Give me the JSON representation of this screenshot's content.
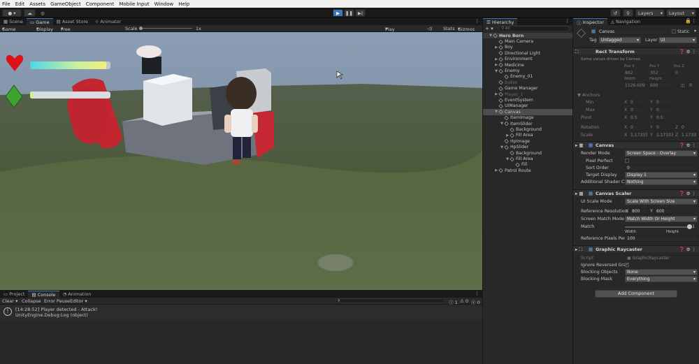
{
  "menu": [
    "File",
    "Edit",
    "Assets",
    "GameObject",
    "Component",
    "Mobile Input",
    "Window",
    "Help"
  ],
  "toolbar": {
    "layers": "Layers",
    "layout": "Layout"
  },
  "game_tabs": [
    "Scene",
    "Game",
    "Asset Store",
    "Animator"
  ],
  "game_bar": {
    "display_mode": "Game",
    "display": "Display 1",
    "aspect": "Free Aspect",
    "scale_label": "Scale",
    "scale_value": "1x",
    "play_focused": "Play Focused",
    "stats": "Stats",
    "gizmos": "Gizmos"
  },
  "hud": {
    "health": 0.95,
    "item": 0.04
  },
  "hierarchy": {
    "title": "Hierarchy",
    "search": "All",
    "items": [
      {
        "label": "Hero Born",
        "depth": 0,
        "arrow": "▼",
        "root": true
      },
      {
        "label": "Main Camera",
        "depth": 1,
        "arrow": ""
      },
      {
        "label": "Boy",
        "depth": 1,
        "arrow": "▶"
      },
      {
        "label": "Directional Light",
        "depth": 1,
        "arrow": ""
      },
      {
        "label": "Environment",
        "depth": 1,
        "arrow": "▶"
      },
      {
        "label": "Medicine",
        "depth": 1,
        "arrow": "▶"
      },
      {
        "label": "Enemy",
        "depth": 1,
        "arrow": "▼"
      },
      {
        "label": "Enemy_01",
        "depth": 2,
        "arrow": ""
      },
      {
        "label": "Bullet",
        "depth": 1,
        "arrow": "",
        "dim": true
      },
      {
        "label": "Game Manager",
        "depth": 1,
        "arrow": ""
      },
      {
        "label": "Player_1",
        "depth": 1,
        "arrow": "▶",
        "dim": true
      },
      {
        "label": "EventSystem",
        "depth": 1,
        "arrow": ""
      },
      {
        "label": "UIManager",
        "depth": 1,
        "arrow": ""
      },
      {
        "label": "Canvas",
        "depth": 1,
        "arrow": "▼",
        "selected": true
      },
      {
        "label": "ItemImage",
        "depth": 2,
        "arrow": ""
      },
      {
        "label": "ItemSlider",
        "depth": 2,
        "arrow": "▼"
      },
      {
        "label": "Background",
        "depth": 3,
        "arrow": ""
      },
      {
        "label": "Fill Area",
        "depth": 3,
        "arrow": "▶"
      },
      {
        "label": "HpImage",
        "depth": 2,
        "arrow": ""
      },
      {
        "label": "HpSlider",
        "depth": 2,
        "arrow": "▼"
      },
      {
        "label": "Background",
        "depth": 3,
        "arrow": ""
      },
      {
        "label": "Fill Area",
        "depth": 3,
        "arrow": "▼"
      },
      {
        "label": "Fill",
        "depth": 4,
        "arrow": ""
      },
      {
        "label": "Patrol Route",
        "depth": 1,
        "arrow": "▶"
      }
    ]
  },
  "inspector": {
    "tabs": [
      "Inspector",
      "Navigation"
    ],
    "name": "Canvas",
    "static": "Static",
    "tag_label": "Tag",
    "tag": "Untagged",
    "layer_label": "Layer",
    "layer": "UI",
    "rect": {
      "title": "Rect Transform",
      "note": "Some values driven by Canvas.",
      "h_posx": "Pos X",
      "h_posy": "Pos Y",
      "h_posz": "Pos Z",
      "posx": "862",
      "posy": "352",
      "posz": "0",
      "h_w": "Width",
      "h_h": "Height",
      "w": "1126.609",
      "h": "600",
      "anchors": "Anchors",
      "min": "Min",
      "max": "Max",
      "ax": "X",
      "ay": "Y",
      "min_x": "0",
      "min_y": "0",
      "max_x": "0",
      "max_y": "0",
      "pivot": "Pivot",
      "piv_x": "0.5",
      "piv_y": "0.5",
      "rotation": "Rotation",
      "rx": "0",
      "ry": "0",
      "rz": "0",
      "az": "Z",
      "scale": "Scale",
      "sx": "1.17333",
      "sy": "1.17333",
      "sz": "1.17333",
      "r_btn": "R"
    },
    "canvas": {
      "title": "Canvas",
      "render_mode_l": "Render Mode",
      "render_mode": "Screen Space - Overlay",
      "pixel_perfect": "Pixel Perfect",
      "sort_order_l": "Sort Order",
      "sort_order": "0",
      "target_display_l": "Target Display",
      "target_display": "Display 1",
      "add_shader_l": "Additional Shader Ch",
      "add_shader": "Nothing"
    },
    "scaler": {
      "title": "Canvas Scaler",
      "ui_scale_l": "UI Scale Mode",
      "ui_scale": "Scale With Screen Size",
      "ref_res_l": "Reference Resolution",
      "ref_x": "800",
      "ref_y": "600",
      "match_mode_l": "Screen Match Mode",
      "match_mode": "Match Width Or Height",
      "match_l": "Match",
      "match": "1",
      "match_value": 1,
      "width": "Width",
      "height": "Height",
      "ref_ppu_l": "Reference Pixels Per",
      "ref_ppu": "100"
    },
    "raycaster": {
      "title": "Graphic Raycaster",
      "script_l": "Script",
      "script": "GraphicRaycaster",
      "ignore_l": "Ignore Reversed Grap",
      "block_obj_l": "Blocking Objects",
      "block_obj": "None",
      "block_mask_l": "Blocking Mask",
      "block_mask": "Everything"
    },
    "add_component": "Add Component"
  },
  "console": {
    "tabs": [
      "Project",
      "Console",
      "Animation"
    ],
    "buttons": [
      "Clear",
      "Collapse",
      "Error Pause",
      "Editor"
    ],
    "counts": [
      "1",
      "0",
      "0"
    ],
    "line1": "[14:28:52] Player detected - Attack!",
    "line2": "UnityEngine.Debug:Log (object)"
  }
}
